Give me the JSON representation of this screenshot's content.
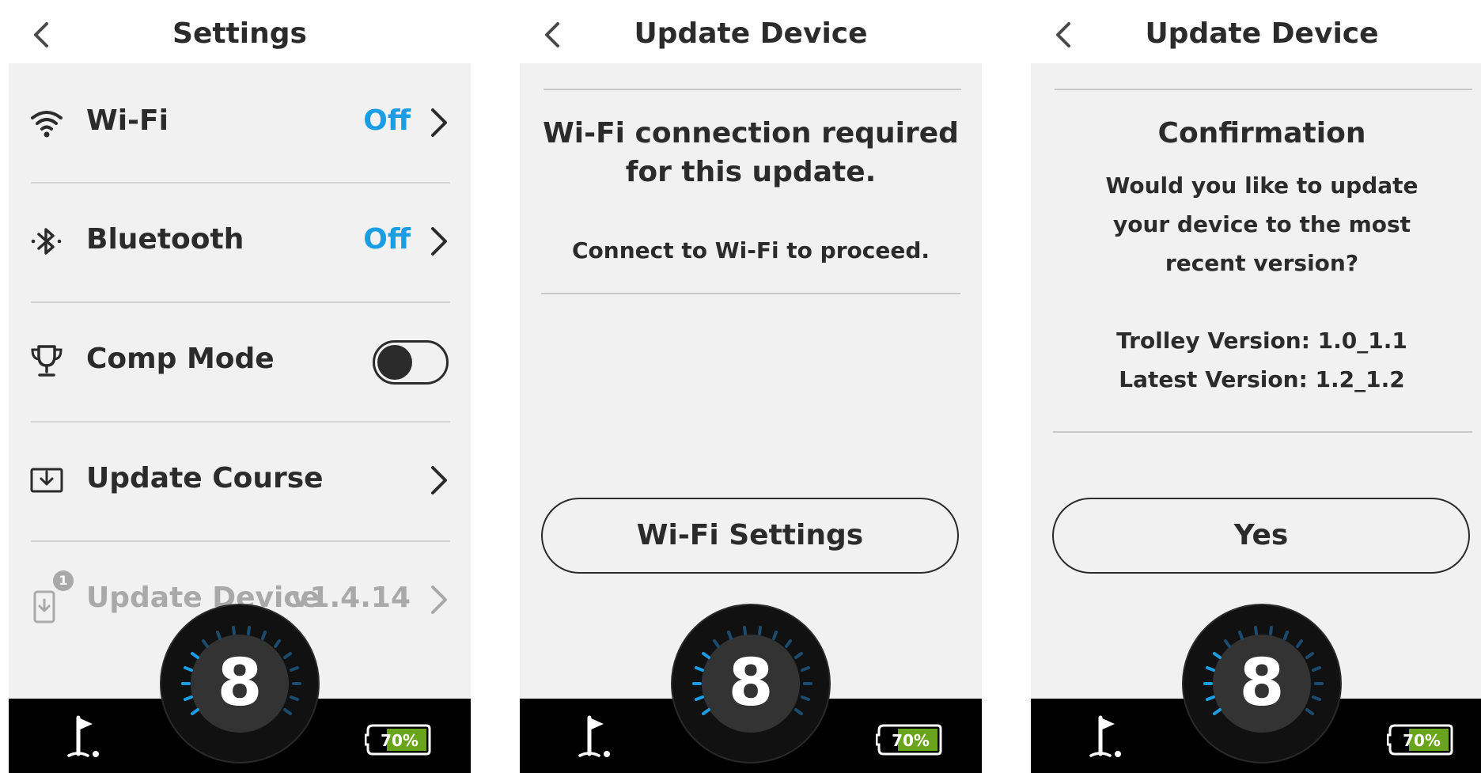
{
  "colors": {
    "accent": "#1a9de3",
    "battery_fill": "#6aa41c",
    "panel_bg": "#f1f1f1",
    "text": "#2b2b2b",
    "disabled": "#a9a9a9"
  },
  "screens": [
    {
      "title": "Settings",
      "items": [
        {
          "icon": "wifi-icon",
          "label": "Wi-Fi",
          "value": "Off"
        },
        {
          "icon": "bluetooth-icon",
          "label": "Bluetooth",
          "value": "Off"
        },
        {
          "icon": "trophy-icon",
          "label": "Comp Mode",
          "toggle": "off"
        },
        {
          "icon": "download-icon",
          "label": "Update Course"
        },
        {
          "icon": "device-update-icon",
          "label": "Update Device",
          "value": "v1.4.14",
          "badge": "1"
        }
      ]
    },
    {
      "title": "Update Device",
      "heading": "Wi-Fi connection required for this update.",
      "message": "Connect to Wi-Fi to proceed.",
      "button": "Wi-Fi Settings"
    },
    {
      "title": "Update Device",
      "heading": "Confirmation",
      "question": "Would you like to update your device to the most recent version?",
      "trolley_version": "Trolley Version: 1.0_1.1",
      "latest_version": "Latest Version: 1.2_1.2",
      "button": "Yes"
    }
  ],
  "bottom_bar": {
    "hole": "8",
    "battery": "70%",
    "flag_icon": "golf-flag-icon"
  }
}
